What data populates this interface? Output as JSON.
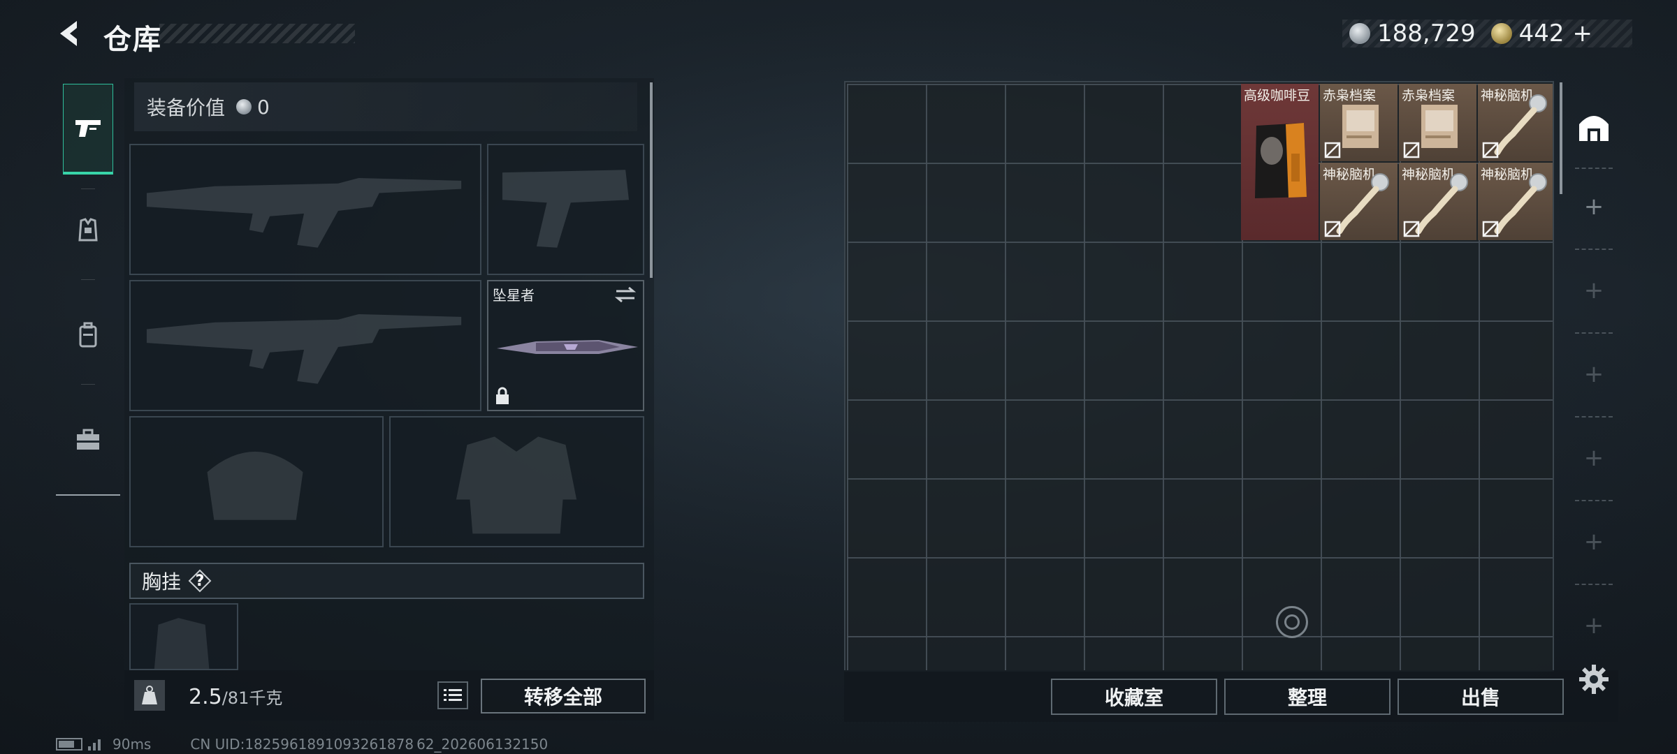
{
  "header": {
    "title": "仓库"
  },
  "currency": {
    "silver": "188,729",
    "gold": "442",
    "gold_plus": "+"
  },
  "equipment": {
    "value_label": "装备价值",
    "value": "0",
    "melee_name": "坠星者",
    "chest_label": "胸挂",
    "chest_help": "?"
  },
  "weight": {
    "current": "2.5",
    "max_unit": "/81千克",
    "kg_icon_label": "KG"
  },
  "buttons": {
    "transfer_all": "转移全部",
    "collection": "收藏室",
    "sort": "整理",
    "sell": "出售"
  },
  "storage": {
    "items": [
      {
        "name": "高级咖啡豆",
        "color": "red",
        "icon": "coffee-bag-icon"
      },
      {
        "name": "赤枭档案",
        "color": "brown",
        "icon": "archive-docs-icon",
        "locked": true
      },
      {
        "name": "赤枭档案",
        "color": "brown",
        "icon": "archive-docs-icon",
        "locked": true
      },
      {
        "name": "神秘脑机...",
        "color": "brown",
        "icon": "brain-interface-icon",
        "locked": true
      },
      {
        "name": "神秘脑机...",
        "color": "brown",
        "icon": "brain-interface-icon",
        "locked": true
      },
      {
        "name": "神秘脑机...",
        "color": "brown",
        "icon": "brain-interface-icon",
        "locked": true
      },
      {
        "name": "神秘脑机...",
        "color": "brown",
        "icon": "brain-interface-icon",
        "locked": true
      }
    ]
  },
  "footer": {
    "ping": "90ms",
    "uid": "CN UID:1825961891093261878 62_202606132150"
  }
}
